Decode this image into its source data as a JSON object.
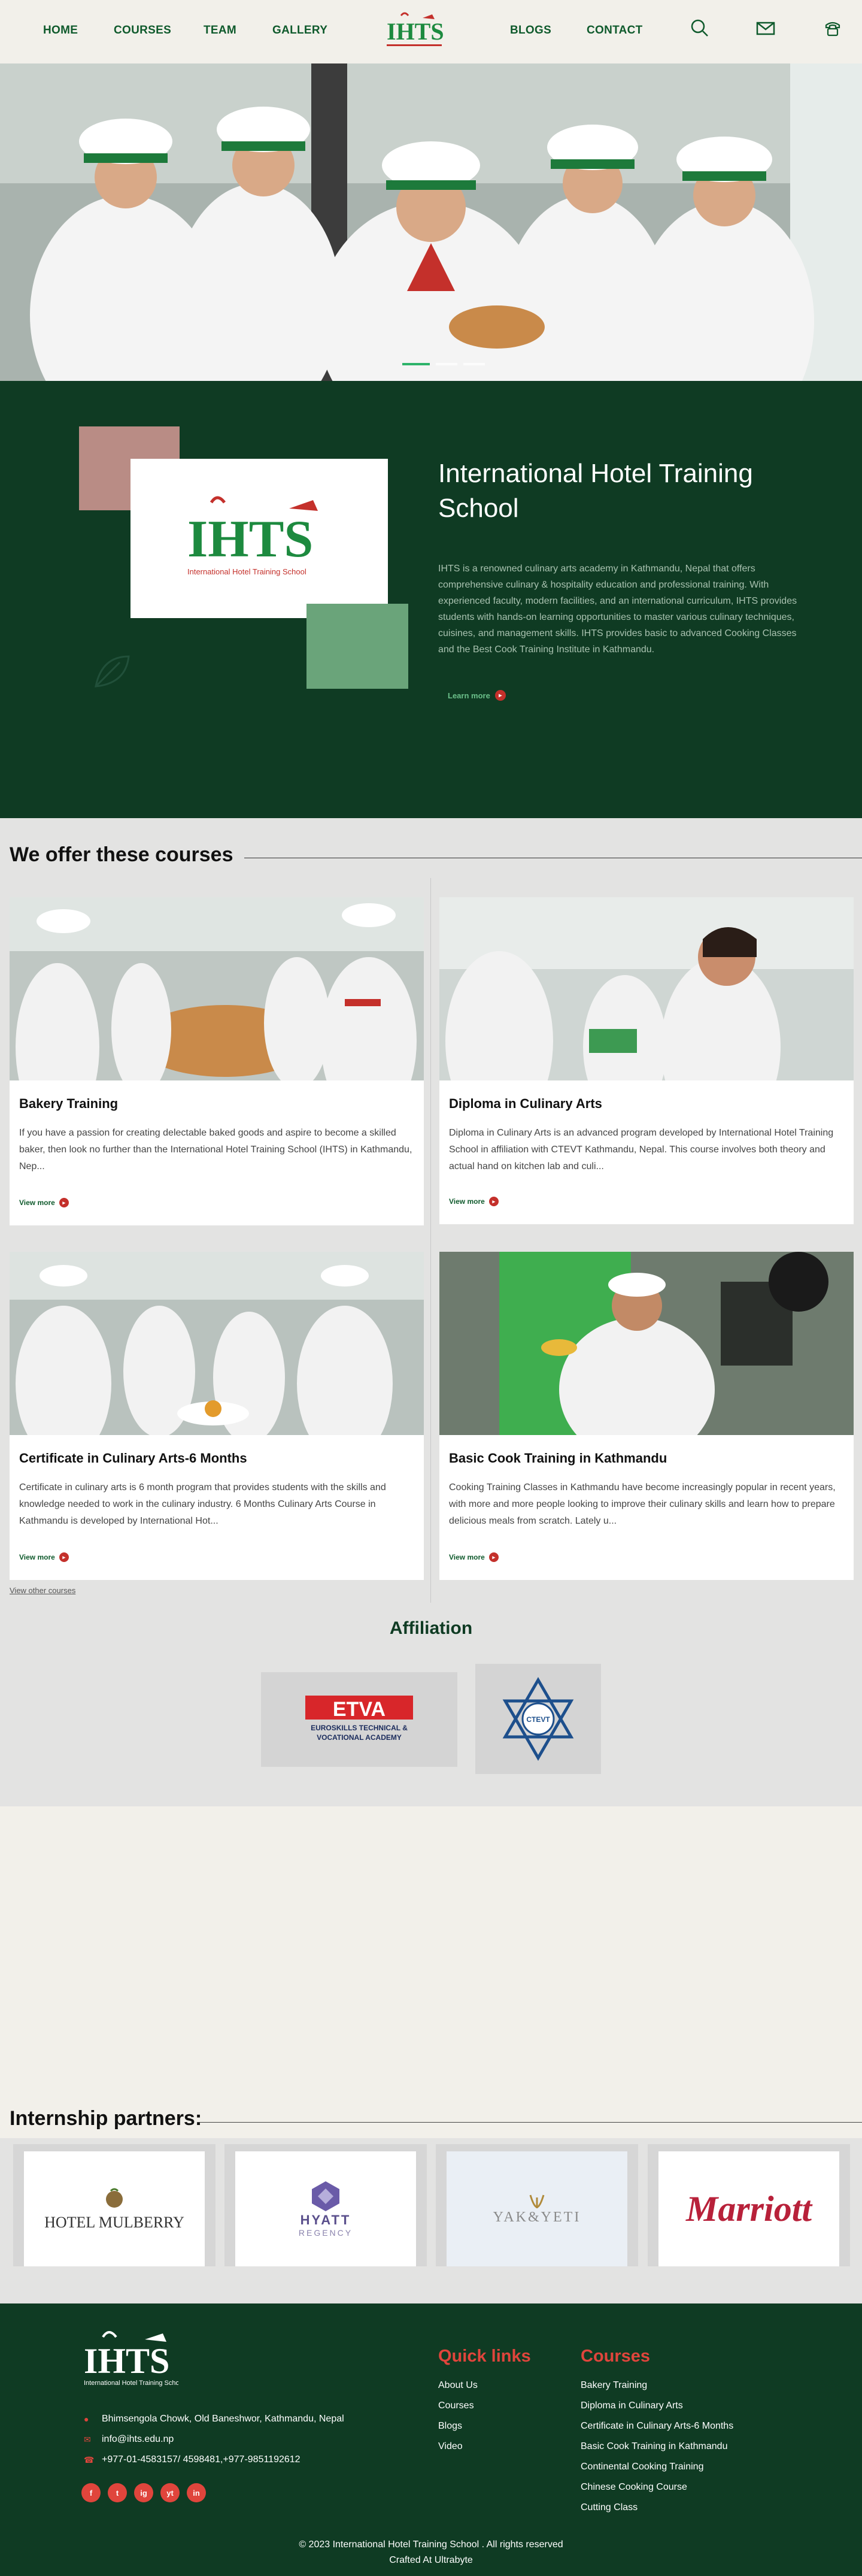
{
  "nav": {
    "home": "HOME",
    "courses": "COURSES",
    "team": "TEAM",
    "gallery": "GALLERY",
    "blogs": "BLOGS",
    "contact": "CONTACT",
    "logo_text": "IHTS"
  },
  "hero": {
    "slides": 3,
    "active_slide": 0
  },
  "about": {
    "title": "International Hotel Training School",
    "text": "IHTS is a renowned culinary arts academy in Kathmandu, Nepal that offers comprehensive culinary & hospitality education and professional training. With experienced faculty, modern facilities, and an international curriculum, IHTS provides students with hands-on learning opportunities to master various culinary techniques, cuisines, and management skills. IHTS provides basic to advanced Cooking Classes and the Best Cook Training Institute in Kathmandu.",
    "learn_more": "Learn more",
    "logo_text": "IHTS",
    "logo_subtext": "International Hotel Training School"
  },
  "courses": {
    "title": "We offer these courses",
    "view_more": "View more",
    "items": [
      {
        "title": "Bakery Training",
        "desc": "If you have a passion for creating delectable baked goods and aspire to become a skilled baker, then look no further than the International Hotel Training School (IHTS) in Kathmandu, Nep..."
      },
      {
        "title": "Diploma in Culinary Arts",
        "desc": "Diploma in Culinary Arts is an advanced program developed by International Hotel Training School in affiliation with CTEVT Kathmandu, Nepal. This course involves both theory and actual hand on kitchen lab and culi..."
      },
      {
        "title": "Certificate in Culinary Arts-6 Months",
        "desc": "Certificate in culinary arts is 6 month program that provides students with the skills and knowledge needed to work in the culinary industry. 6 Months Culinary Arts Course in Kathmandu is developed by International Hot..."
      },
      {
        "title": "Basic Cook Training in Kathmandu",
        "desc": "Cooking Training Classes in Kathmandu have become increasingly popular in recent years, with more and more people looking to improve their culinary skills and learn how to prepare delicious meals from scratch. Lately u..."
      }
    ],
    "view_other": "View other courses"
  },
  "affiliation": {
    "title": "Affiliation",
    "etva_main": "ETVA",
    "etva_sub1": "EUROSKILLS TECHNICAL &",
    "etva_sub2": "VOCATIONAL ACADEMY",
    "ctevt": "CTEVT"
  },
  "internship": {
    "title": "Internship partners:",
    "partners": [
      {
        "name": "HOTEL MULBERRY"
      },
      {
        "name": "HYATT",
        "sub": "REGENCY"
      },
      {
        "name": "YAK&YETI"
      },
      {
        "name": "Marriott"
      }
    ]
  },
  "footer": {
    "address": "Bhimsengola Chowk, Old Baneshwor, Kathmandu, Nepal",
    "email": "info@ihts.edu.np",
    "phone": "+977-01-4583157/ 4598481,+977-9851192612",
    "quick_links_title": "Quick links",
    "quick_links": [
      "About Us",
      "Courses",
      "Blogs",
      "Video"
    ],
    "courses_title": "Courses",
    "courses": [
      "Bakery Training",
      "Diploma in Culinary Arts",
      "Certificate in Culinary Arts-6 Months",
      "Basic Cook Training in Kathmandu",
      "Continental Cooking Training",
      "Chinese Cooking Course",
      "Cutting Class"
    ],
    "copyright": "© 2023 International Hotel Training School . All rights reserved",
    "crafted": "Crafted At Ultrabyte",
    "socials": [
      "f",
      "t",
      "ig",
      "yt",
      "in"
    ]
  },
  "colors": {
    "dark_green": "#0f3b23",
    "brand_green": "#0f5a2c",
    "accent_red": "#e0453c",
    "pink": "#b98c85",
    "light_green": "#6aa47a"
  }
}
